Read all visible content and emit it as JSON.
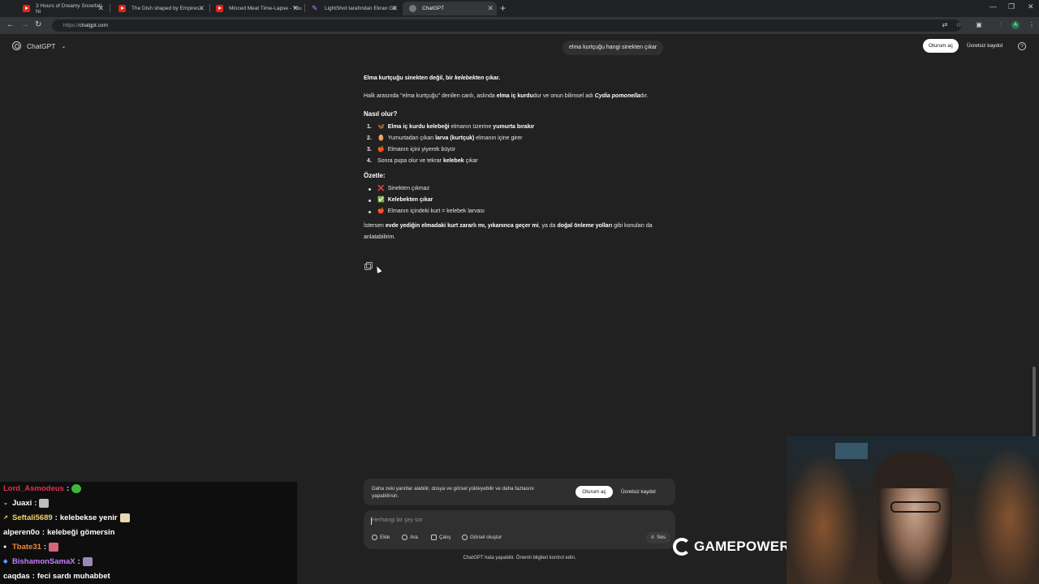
{
  "browser": {
    "tabs": [
      {
        "title": "3 Hours of Dreamy Snowfall Ni",
        "icon": "youtube-icon"
      },
      {
        "title": "The Dish shaped by Empires...",
        "icon": "youtube-icon"
      },
      {
        "title": "Minced Meat Time-Lapse - You",
        "icon": "youtube-icon"
      },
      {
        "title": "LightShot tarafından Ekran Gö",
        "icon": "lightshot-icon"
      },
      {
        "title": "ChatGPT",
        "icon": "chatgpt-icon",
        "active": true
      }
    ],
    "url_scheme": "https://",
    "url_host": "chatgpt.com"
  },
  "header": {
    "brand": "ChatGPT",
    "login": "Oturum aç",
    "signup": "Ücretsiz kaydol"
  },
  "conversation": {
    "user_message": "elma kurtçuğu hangi sinekten çıkar",
    "answer": {
      "p1": {
        "b1": "Elma kurtçuğu sinekten değil, bir ",
        "i1": "kelebekten",
        "b2": " çıkar."
      },
      "p2": {
        "t1": "Halk arasında \"elma kurtçuğu\" denilen canlı, aslında ",
        "b1": "elma iç kurdu",
        "t2": "dur ve onun bilimsel adı ",
        "i1": "Cydia pomonella",
        "t3": "dır."
      },
      "h_how": "Nasıl olur?",
      "steps": [
        {
          "n": "1.",
          "emoji": "🦋",
          "b1": "Elma iç kurdu kelebeği",
          "t1": " elmanın üzerine ",
          "b2": "yumurta bırakır",
          "t2": ""
        },
        {
          "n": "2.",
          "emoji": "🥚",
          "b1": "",
          "t1": "Yumurtadan çıkan ",
          "b2": "larva (kurtçuk)",
          "t2": " elmanın içine girer"
        },
        {
          "n": "3.",
          "emoji": "🍎",
          "b1": "",
          "t1": "Elmanın içini yiyerek büyür",
          "b2": "",
          "t2": ""
        },
        {
          "n": "4.",
          "emoji": "",
          "b1": "",
          "t1": "Sonra pupa olur ve tekrar ",
          "b2": "kelebek",
          "t2": " çıkar"
        }
      ],
      "h_summary": "Özetle:",
      "summary": [
        {
          "emoji": "❌",
          "text": "Sinekten çıkmaz",
          "bold": false
        },
        {
          "emoji": "✅",
          "text": "Kelebekten çıkar",
          "bold": true
        },
        {
          "emoji": "🍎",
          "text": "Elmanın içindeki kurt = kelebek larvası",
          "bold": false
        }
      ],
      "p3": {
        "t1": "İstersen ",
        "b1": "evde yediğin elmadaki kurt zararlı mı, yıkanınca geçer mi",
        "t2": ", ya da ",
        "b2": "doğal önleme yolları",
        "t3": " gibi konuları da anlatabilirim."
      }
    }
  },
  "promo": {
    "text": "Daha zeki yanıtlar alabilir, dosya ve görsel yükleyebilir ve daha fazlasını yapabilirsin.",
    "login": "Oturum aç",
    "signup": "Ücretsiz kaydol"
  },
  "composer": {
    "placeholder": "Herhangi bir şey sor",
    "buttons": {
      "attach": "Ekle",
      "search": "Ara",
      "study": "Çalış",
      "image": "Görsel oluştur",
      "voice": "Ses"
    }
  },
  "footer_note": "ChatGPT hata yapabilir. Önemli bilgileri kontrol edin.",
  "stream_chat": [
    {
      "user": "Lord_Asmodeus",
      "color": "#e0314d",
      "msg": "",
      "emote": "green"
    },
    {
      "user": "Juaxi",
      "color": "#ffffff",
      "msg": "",
      "emote": "gray"
    },
    {
      "user": "Seftali5689",
      "color": "#f2d46b",
      "msg": "kelebekse yenir",
      "emote": "beige"
    },
    {
      "user": "alperen0o",
      "color": "#ffffff",
      "msg": "kelebeği gömersin",
      "emote": ""
    },
    {
      "user": "Tbate31",
      "color": "#f08a3a",
      "msg": "",
      "emote": "pink"
    },
    {
      "user": "BishamonSamaX",
      "color": "#c77dff",
      "msg": "",
      "emote": "purple"
    },
    {
      "user": "caqdas",
      "color": "#ffffff",
      "msg": "feci sardı muhabbet",
      "emote": ""
    }
  ],
  "overlay_logo": "GAMEPOWER"
}
